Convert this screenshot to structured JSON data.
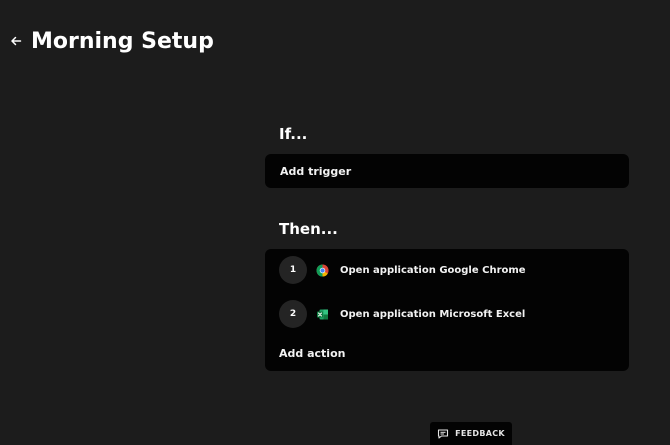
{
  "header": {
    "back_icon": "arrow-left-icon",
    "title": "Morning Setup"
  },
  "if_section": {
    "label": "If...",
    "trigger_label": "Add trigger"
  },
  "then_section": {
    "label": "Then...",
    "actions": [
      {
        "number": "1",
        "icon": "google-chrome-icon",
        "label": "Open application Google Chrome"
      },
      {
        "number": "2",
        "icon": "microsoft-excel-icon",
        "label": "Open application Microsoft Excel"
      }
    ],
    "add_action_label": "Add action"
  },
  "feedback": {
    "icon": "feedback-icon",
    "label": "FEEDBACK"
  },
  "colors": {
    "background": "#1c1c1c",
    "card": "#030303",
    "step_circle": "#242424",
    "text": "#ffffff"
  }
}
